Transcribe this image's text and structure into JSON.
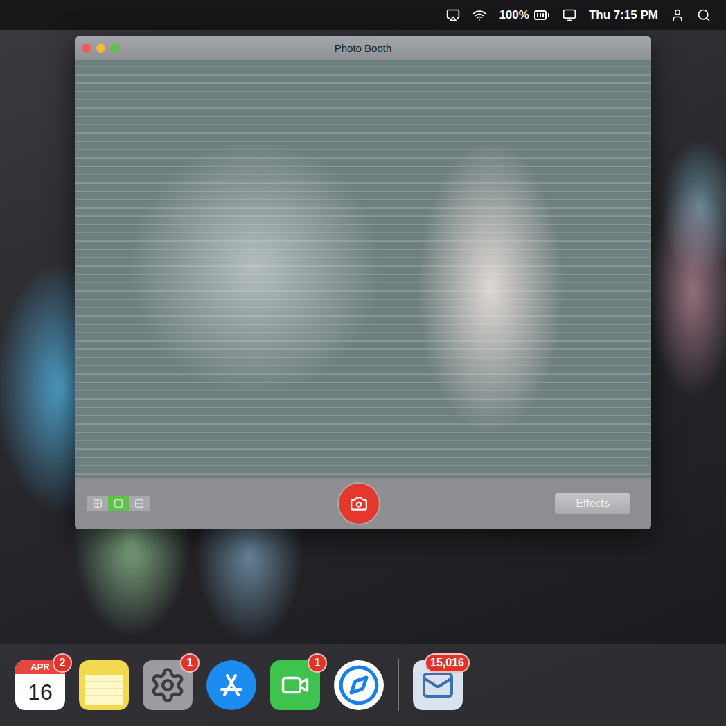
{
  "menu_bar": {
    "battery": "100%",
    "clock": "Thu 7:15 PM"
  },
  "window": {
    "title": "Photo Booth"
  },
  "view_modes": [
    {
      "selected": false
    },
    {
      "selected": true
    },
    {
      "selected": false
    }
  ],
  "effects_button": "Effects",
  "dock": [
    {
      "kind": "calendar",
      "month": "APR",
      "day": "16",
      "badge": "2"
    },
    {
      "kind": "notes"
    },
    {
      "kind": "settings",
      "badge": "1"
    },
    {
      "kind": "app-store"
    },
    {
      "kind": "facetime",
      "badge": "1"
    },
    {
      "kind": "safari"
    },
    {
      "kind": "separator"
    },
    {
      "kind": "mail",
      "badge": "15,016"
    }
  ]
}
